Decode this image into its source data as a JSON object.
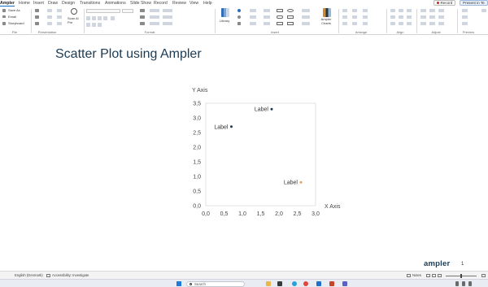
{
  "tabs": [
    "Ampler",
    "Home",
    "Insert",
    "Draw",
    "Design",
    "Transitions",
    "Animations",
    "Slide Show",
    "Record",
    "Review",
    "View",
    "Help"
  ],
  "active_tab": "Ampler",
  "record_label": "Record",
  "present_label": "Present in Te",
  "ribbon": {
    "file_buttons": [
      "Save As",
      "Email",
      "Storyboard"
    ],
    "group_labels": [
      "File",
      "Presentation",
      "Format",
      "Insert",
      "Arrange",
      "Align",
      "Adjust",
      "Preview"
    ],
    "scan_label": "Scan Al Pre",
    "library_label": "Library",
    "charts_label": "Ampler Charts"
  },
  "slide": {
    "title": "Scatter Plot using Ampler",
    "brand": "ampler",
    "number": "1"
  },
  "chart_data": {
    "type": "scatter",
    "xlabel": "X Axis",
    "ylabel": "Y Axis",
    "xlim": [
      0,
      3
    ],
    "ylim": [
      0,
      3.5
    ],
    "x_ticks": [
      "0,0",
      "0,5",
      "1,0",
      "1,5",
      "2,0",
      "2,5",
      "3,0"
    ],
    "y_ticks": [
      "0,0",
      "0,5",
      "1,0",
      "1,5",
      "2,0",
      "2,5",
      "3,0",
      "3,5"
    ],
    "grid": false,
    "points": [
      {
        "x": 0.7,
        "y": 2.7,
        "label": "Label",
        "color": "#1b3b54"
      },
      {
        "x": 1.8,
        "y": 3.3,
        "label": "Label",
        "color": "#1b3b54"
      },
      {
        "x": 2.6,
        "y": 0.8,
        "label": "Label",
        "color": "#e0a055"
      }
    ]
  },
  "statusbar": {
    "slide_info": "English (Denmark)",
    "accessibility": "Accessibility: Investigate",
    "notes": "Notes"
  },
  "taskbar": {
    "search_placeholder": "Search"
  },
  "colors": {
    "accent": "#0f6fc6",
    "title": "#1b3b54",
    "point_highlight": "#e0a055"
  }
}
